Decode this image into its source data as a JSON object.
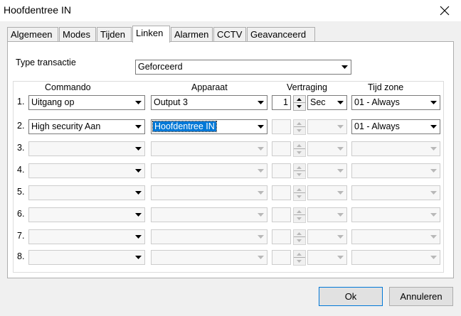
{
  "window": {
    "title": "Hoofdentree IN"
  },
  "tabs": [
    {
      "label": "Algemeen"
    },
    {
      "label": "Modes"
    },
    {
      "label": "Tijden"
    },
    {
      "label": "Linken",
      "active": true
    },
    {
      "label": "Alarmen"
    },
    {
      "label": "CCTV"
    },
    {
      "label": "Geavanceerd"
    }
  ],
  "form": {
    "type_label": "Type transactie",
    "type_value": "Geforceerd"
  },
  "columns": {
    "commando": "Commando",
    "apparaat": "Apparaat",
    "vertraging": "Vertraging",
    "tijdzone": "Tijd zone"
  },
  "rows": [
    {
      "num": "1.",
      "commando": "Uitgang op",
      "apparaat": "Output 3",
      "delay": "1",
      "unit": "Sec",
      "tijdzone": "01 - Always"
    },
    {
      "num": "2.",
      "commando": "High security Aan",
      "apparaat": "Hoofdentree IN",
      "delay": "",
      "unit": "",
      "tijdzone": "01 - Always"
    },
    {
      "num": "3.",
      "commando": "",
      "apparaat": "",
      "delay": "",
      "unit": "",
      "tijdzone": ""
    },
    {
      "num": "4.",
      "commando": "",
      "apparaat": "",
      "delay": "",
      "unit": "",
      "tijdzone": ""
    },
    {
      "num": "5.",
      "commando": "",
      "apparaat": "",
      "delay": "",
      "unit": "",
      "tijdzone": ""
    },
    {
      "num": "6.",
      "commando": "",
      "apparaat": "",
      "delay": "",
      "unit": "",
      "tijdzone": ""
    },
    {
      "num": "7.",
      "commando": "",
      "apparaat": "",
      "delay": "",
      "unit": "",
      "tijdzone": ""
    },
    {
      "num": "8.",
      "commando": "",
      "apparaat": "",
      "delay": "",
      "unit": "",
      "tijdzone": ""
    }
  ],
  "buttons": {
    "ok": "Ok",
    "cancel": "Annuleren"
  },
  "icons": {
    "close": "close-icon",
    "dropdown": "chevron-down-icon",
    "spin_up": "spin-up-icon",
    "spin_down": "spin-down-icon"
  },
  "colors": {
    "selection": "#0078d7",
    "panel": "#ffffff",
    "dialog": "#f0f0f0"
  }
}
